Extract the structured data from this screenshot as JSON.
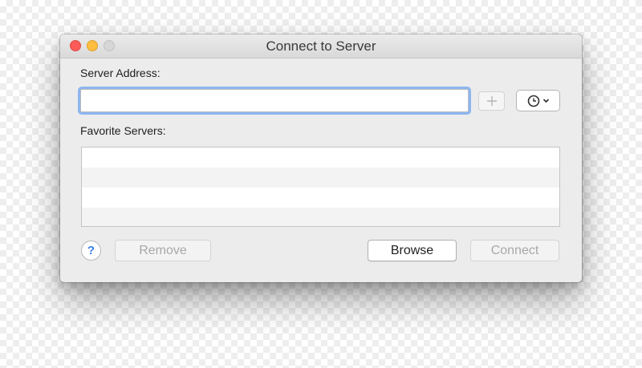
{
  "window": {
    "title": "Connect to Server"
  },
  "server_address": {
    "label": "Server Address:",
    "value": "",
    "placeholder": ""
  },
  "favorites": {
    "label": "Favorite Servers:",
    "items": []
  },
  "buttons": {
    "remove_label": "Remove",
    "browse_label": "Browse",
    "connect_label": "Connect",
    "help_label": "?"
  },
  "icons": {
    "add": "plus-icon",
    "recent": "clock-icon",
    "recent_menu": "chevron-down-icon"
  },
  "colors": {
    "close": "#fc5b57",
    "minimize": "#fdbd3e",
    "zoom": "#d6d6d6",
    "focus_ring": "#8db6f0",
    "help_accent": "#3a7ee8"
  }
}
